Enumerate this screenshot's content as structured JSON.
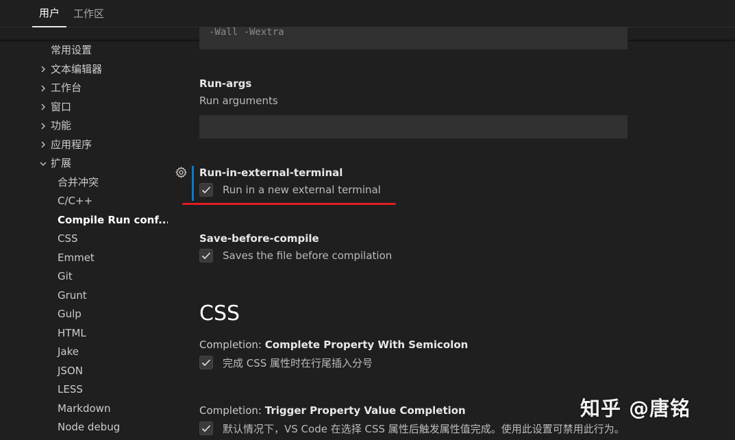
{
  "tabs": [
    {
      "label": "用户",
      "active": true
    },
    {
      "label": "工作区",
      "active": false
    }
  ],
  "sidebar": {
    "items": [
      {
        "label": "常用设置",
        "chevron": "none"
      },
      {
        "label": "文本编辑器",
        "chevron": "right"
      },
      {
        "label": "工作台",
        "chevron": "right"
      },
      {
        "label": "窗口",
        "chevron": "right"
      },
      {
        "label": "功能",
        "chevron": "right"
      },
      {
        "label": "应用程序",
        "chevron": "right"
      },
      {
        "label": "扩展",
        "chevron": "down"
      },
      {
        "label": "合并冲突",
        "chevron": "none"
      },
      {
        "label": "C/C++",
        "chevron": "none"
      },
      {
        "label": "Compile Run conf...",
        "chevron": "none",
        "selected": true
      },
      {
        "label": "CSS",
        "chevron": "none"
      },
      {
        "label": "Emmet",
        "chevron": "none"
      },
      {
        "label": "Git",
        "chevron": "none"
      },
      {
        "label": "Grunt",
        "chevron": "none"
      },
      {
        "label": "Gulp",
        "chevron": "none"
      },
      {
        "label": "HTML",
        "chevron": "none"
      },
      {
        "label": "Jake",
        "chevron": "none"
      },
      {
        "label": "JSON",
        "chevron": "none"
      },
      {
        "label": "LESS",
        "chevron": "none"
      },
      {
        "label": "Markdown",
        "chevron": "none"
      },
      {
        "label": "Node debug",
        "chevron": "none"
      }
    ]
  },
  "settings": {
    "partial_field_value": "-Wall -Wextra",
    "run_args": {
      "title": "Run-args",
      "description": "Run arguments",
      "value": ""
    },
    "run_in_external_terminal": {
      "title": "Run-in-external-terminal",
      "checkbox_label": "Run in a new external terminal",
      "checked": true
    },
    "save_before_compile": {
      "title": "Save-before-compile",
      "checkbox_label": "Saves the file before compilation",
      "checked": true
    },
    "css_section": {
      "heading": "CSS",
      "completion_semicolon": {
        "category": "Completion: ",
        "title": "Complete Property With Semicolon",
        "checkbox_label": "完成 CSS 属性时在行尾插入分号",
        "checked": true
      },
      "trigger_completion": {
        "category": "Completion: ",
        "title": "Trigger Property Value Completion",
        "checkbox_label": "默认情况下，VS Code 在选择 CSS 属性后触发属性值完成。使用此设置可禁用此行为。",
        "checked": true
      }
    }
  },
  "watermark": "知乎 @唐铭",
  "colors": {
    "background": "#1f1f1f",
    "input_background": "#313131",
    "focus_bar": "#0a7aca",
    "annotation_underline": "#e11d21"
  },
  "icons": {
    "gear": "gear-icon",
    "check": "check-icon",
    "chevron_right": "chevron-right-icon",
    "chevron_down": "chevron-down-icon"
  }
}
